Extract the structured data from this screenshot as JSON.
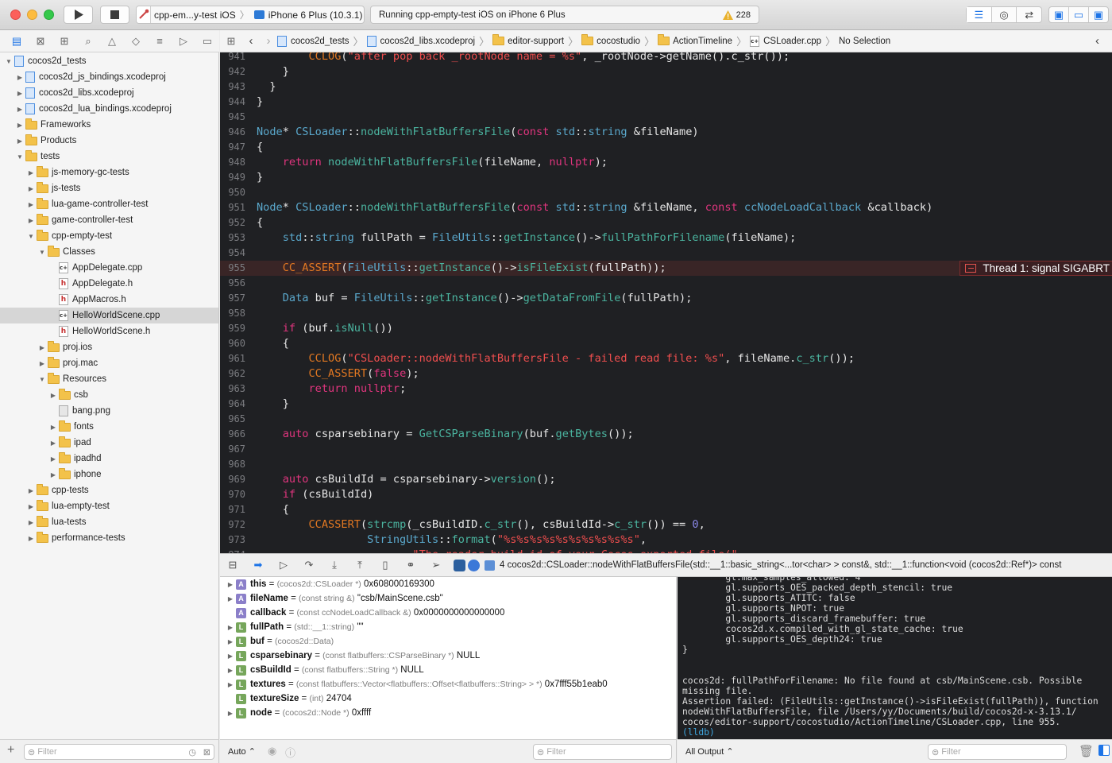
{
  "toolbar": {
    "scheme_name": "cpp-em...y-test iOS",
    "device_name": "iPhone 6 Plus (10.3.1)",
    "status_text": "Running cpp-empty-test iOS on iPhone 6 Plus",
    "warning_count": "228"
  },
  "navigator": {
    "filter_placeholder": "Filter",
    "items": [
      {
        "label": "cocos2d_tests",
        "icon": "project",
        "depth": 0,
        "disclosure": "open"
      },
      {
        "label": "cocos2d_js_bindings.xcodeproj",
        "icon": "project",
        "depth": 1,
        "disclosure": "closed"
      },
      {
        "label": "cocos2d_libs.xcodeproj",
        "icon": "project",
        "depth": 1,
        "disclosure": "closed"
      },
      {
        "label": "cocos2d_lua_bindings.xcodeproj",
        "icon": "project",
        "depth": 1,
        "disclosure": "closed"
      },
      {
        "label": "Frameworks",
        "icon": "folder",
        "depth": 1,
        "disclosure": "closed"
      },
      {
        "label": "Products",
        "icon": "folder",
        "depth": 1,
        "disclosure": "closed"
      },
      {
        "label": "tests",
        "icon": "folder",
        "depth": 1,
        "disclosure": "open"
      },
      {
        "label": "js-memory-gc-tests",
        "icon": "folder",
        "depth": 2,
        "disclosure": "closed"
      },
      {
        "label": "js-tests",
        "icon": "folder",
        "depth": 2,
        "disclosure": "closed"
      },
      {
        "label": "lua-game-controller-test",
        "icon": "folder",
        "depth": 2,
        "disclosure": "closed"
      },
      {
        "label": "game-controller-test",
        "icon": "folder",
        "depth": 2,
        "disclosure": "closed"
      },
      {
        "label": "cpp-empty-test",
        "icon": "folder",
        "depth": 2,
        "disclosure": "open"
      },
      {
        "label": "Classes",
        "icon": "folder",
        "depth": 3,
        "disclosure": "open"
      },
      {
        "label": "AppDelegate.cpp",
        "icon": "cpp",
        "depth": 4,
        "disclosure": "none"
      },
      {
        "label": "AppDelegate.h",
        "icon": "h",
        "depth": 4,
        "disclosure": "none"
      },
      {
        "label": "AppMacros.h",
        "icon": "h",
        "depth": 4,
        "disclosure": "none"
      },
      {
        "label": "HelloWorldScene.cpp",
        "icon": "cpp",
        "depth": 4,
        "disclosure": "none",
        "selected": true
      },
      {
        "label": "HelloWorldScene.h",
        "icon": "h",
        "depth": 4,
        "disclosure": "none"
      },
      {
        "label": "proj.ios",
        "icon": "folder",
        "depth": 3,
        "disclosure": "closed"
      },
      {
        "label": "proj.mac",
        "icon": "folder",
        "depth": 3,
        "disclosure": "closed"
      },
      {
        "label": "Resources",
        "icon": "folder",
        "depth": 3,
        "disclosure": "open"
      },
      {
        "label": "csb",
        "icon": "folder",
        "depth": 4,
        "disclosure": "closed"
      },
      {
        "label": "bang.png",
        "icon": "image",
        "depth": 4,
        "disclosure": "none"
      },
      {
        "label": "fonts",
        "icon": "folder",
        "depth": 4,
        "disclosure": "closed"
      },
      {
        "label": "ipad",
        "icon": "folder",
        "depth": 4,
        "disclosure": "closed"
      },
      {
        "label": "ipadhd",
        "icon": "folder",
        "depth": 4,
        "disclosure": "closed"
      },
      {
        "label": "iphone",
        "icon": "folder",
        "depth": 4,
        "disclosure": "closed"
      },
      {
        "label": "cpp-tests",
        "icon": "folder",
        "depth": 2,
        "disclosure": "closed"
      },
      {
        "label": "lua-empty-test",
        "icon": "folder",
        "depth": 2,
        "disclosure": "closed"
      },
      {
        "label": "lua-tests",
        "icon": "folder",
        "depth": 2,
        "disclosure": "closed"
      },
      {
        "label": "performance-tests",
        "icon": "folder",
        "depth": 2,
        "disclosure": "closed"
      }
    ]
  },
  "jumpbar": {
    "crumbs": [
      "cocos2d_tests",
      "cocos2d_libs.xcodeproj",
      "editor-support",
      "cocostudio",
      "ActionTimeline",
      "CSLoader.cpp",
      "No Selection"
    ]
  },
  "editor": {
    "error_badge": "Thread 1: signal SIGABRT",
    "error_line": "955",
    "lines": [
      {
        "n": "941",
        "code": [
          [
            "        ",
            ""
          ],
          [
            "CCLOG",
            "mc"
          ],
          [
            "(",
            ""
          ],
          [
            "\"after pop back _rootNode name = %s\"",
            "st"
          ],
          [
            ", _rootNode->getName().c_str());",
            ""
          ]
        ]
      },
      {
        "n": "942",
        "code": [
          [
            "    }",
            ""
          ]
        ]
      },
      {
        "n": "943",
        "code": [
          [
            "  }",
            ""
          ]
        ]
      },
      {
        "n": "944",
        "code": [
          [
            "}",
            ""
          ]
        ]
      },
      {
        "n": "945",
        "code": []
      },
      {
        "n": "946",
        "code": [
          [
            "Node",
            "ty"
          ],
          [
            "* ",
            ""
          ],
          [
            "CSLoader",
            "ty"
          ],
          [
            "::",
            ""
          ],
          [
            "nodeWithFlatBuffersFile",
            "fn"
          ],
          [
            "(",
            ""
          ],
          [
            "const",
            "kw"
          ],
          [
            " ",
            ""
          ],
          [
            "std",
            "ty"
          ],
          [
            "::",
            ""
          ],
          [
            "string",
            "ty"
          ],
          [
            " &fileName)",
            ""
          ]
        ]
      },
      {
        "n": "947",
        "code": [
          [
            "{",
            ""
          ]
        ]
      },
      {
        "n": "948",
        "code": [
          [
            "    ",
            ""
          ],
          [
            "return",
            "kw"
          ],
          [
            " ",
            ""
          ],
          [
            "nodeWithFlatBuffersFile",
            "fn"
          ],
          [
            "(fileName, ",
            ""
          ],
          [
            "nullptr",
            "kw"
          ],
          [
            ");",
            ""
          ]
        ]
      },
      {
        "n": "949",
        "code": [
          [
            "}",
            ""
          ]
        ]
      },
      {
        "n": "950",
        "code": []
      },
      {
        "n": "951",
        "code": [
          [
            "Node",
            "ty"
          ],
          [
            "* ",
            ""
          ],
          [
            "CSLoader",
            "ty"
          ],
          [
            "::",
            ""
          ],
          [
            "nodeWithFlatBuffersFile",
            "fn"
          ],
          [
            "(",
            ""
          ],
          [
            "const",
            "kw"
          ],
          [
            " ",
            ""
          ],
          [
            "std",
            "ty"
          ],
          [
            "::",
            ""
          ],
          [
            "string",
            "ty"
          ],
          [
            " &fileName, ",
            ""
          ],
          [
            "const",
            "kw"
          ],
          [
            " ",
            ""
          ],
          [
            "ccNodeLoadCallback",
            "ty"
          ],
          [
            " &callback)",
            ""
          ]
        ]
      },
      {
        "n": "952",
        "code": [
          [
            "{",
            ""
          ]
        ]
      },
      {
        "n": "953",
        "code": [
          [
            "    ",
            ""
          ],
          [
            "std",
            "ty"
          ],
          [
            "::",
            ""
          ],
          [
            "string",
            "ty"
          ],
          [
            " fullPath = ",
            ""
          ],
          [
            "FileUtils",
            "ty"
          ],
          [
            "::",
            ""
          ],
          [
            "getInstance",
            "fn"
          ],
          [
            "()->",
            ""
          ],
          [
            "fullPathForFilename",
            "fn"
          ],
          [
            "(fileName);",
            ""
          ]
        ]
      },
      {
        "n": "954",
        "code": []
      },
      {
        "n": "955",
        "code": [
          [
            "    ",
            ""
          ],
          [
            "CC_ASSERT",
            "mc"
          ],
          [
            "(",
            ""
          ],
          [
            "FileUtils",
            "ty"
          ],
          [
            "::",
            ""
          ],
          [
            "getInstance",
            "fn"
          ],
          [
            "()->",
            ""
          ],
          [
            "isFileExist",
            "fn"
          ],
          [
            "(fullPath));",
            ""
          ]
        ]
      },
      {
        "n": "956",
        "code": []
      },
      {
        "n": "957",
        "code": [
          [
            "    ",
            ""
          ],
          [
            "Data",
            "ty"
          ],
          [
            " buf = ",
            ""
          ],
          [
            "FileUtils",
            "ty"
          ],
          [
            "::",
            ""
          ],
          [
            "getInstance",
            "fn"
          ],
          [
            "()->",
            ""
          ],
          [
            "getDataFromFile",
            "fn"
          ],
          [
            "(fullPath);",
            ""
          ]
        ]
      },
      {
        "n": "958",
        "code": []
      },
      {
        "n": "959",
        "code": [
          [
            "    ",
            ""
          ],
          [
            "if",
            "kw"
          ],
          [
            " (buf.",
            ""
          ],
          [
            "isNull",
            "fn"
          ],
          [
            "())",
            ""
          ]
        ]
      },
      {
        "n": "960",
        "code": [
          [
            "    {",
            ""
          ]
        ]
      },
      {
        "n": "961",
        "code": [
          [
            "        ",
            ""
          ],
          [
            "CCLOG",
            "mc"
          ],
          [
            "(",
            ""
          ],
          [
            "\"CSLoader::nodeWithFlatBuffersFile - failed read file: %s\"",
            "st"
          ],
          [
            ", fileName.",
            ""
          ],
          [
            "c_str",
            "fn"
          ],
          [
            "());",
            ""
          ]
        ]
      },
      {
        "n": "962",
        "code": [
          [
            "        ",
            ""
          ],
          [
            "CC_ASSERT",
            "mc"
          ],
          [
            "(",
            ""
          ],
          [
            "false",
            "kw"
          ],
          [
            ");",
            ""
          ]
        ]
      },
      {
        "n": "963",
        "code": [
          [
            "        ",
            ""
          ],
          [
            "return",
            "kw"
          ],
          [
            " ",
            ""
          ],
          [
            "nullptr",
            "kw"
          ],
          [
            ";",
            ""
          ]
        ]
      },
      {
        "n": "964",
        "code": [
          [
            "    }",
            ""
          ]
        ]
      },
      {
        "n": "965",
        "code": []
      },
      {
        "n": "966",
        "code": [
          [
            "    ",
            ""
          ],
          [
            "auto",
            "kw"
          ],
          [
            " csparsebinary = ",
            ""
          ],
          [
            "GetCSParseBinary",
            "fn"
          ],
          [
            "(buf.",
            ""
          ],
          [
            "getBytes",
            "fn"
          ],
          [
            "());",
            ""
          ]
        ]
      },
      {
        "n": "967",
        "code": []
      },
      {
        "n": "968",
        "code": []
      },
      {
        "n": "969",
        "code": [
          [
            "    ",
            ""
          ],
          [
            "auto",
            "kw"
          ],
          [
            " csBuildId = csparsebinary->",
            ""
          ],
          [
            "version",
            "fn"
          ],
          [
            "();",
            ""
          ]
        ]
      },
      {
        "n": "970",
        "code": [
          [
            "    ",
            ""
          ],
          [
            "if",
            "kw"
          ],
          [
            " (csBuildId)",
            ""
          ]
        ]
      },
      {
        "n": "971",
        "code": [
          [
            "    {",
            ""
          ]
        ]
      },
      {
        "n": "972",
        "code": [
          [
            "        ",
            ""
          ],
          [
            "CCASSERT",
            "mc"
          ],
          [
            "(",
            ""
          ],
          [
            "strcmp",
            "fn"
          ],
          [
            "(_csBuildID.",
            ""
          ],
          [
            "c_str",
            "fn"
          ],
          [
            "(), csBuildId->",
            ""
          ],
          [
            "c_str",
            "fn"
          ],
          [
            "()) == ",
            ""
          ],
          [
            "0",
            "nm"
          ],
          [
            ",",
            ""
          ]
        ]
      },
      {
        "n": "973",
        "code": [
          [
            "                 ",
            ""
          ],
          [
            "StringUtils",
            "ty"
          ],
          [
            "::",
            ""
          ],
          [
            "format",
            "fn"
          ],
          [
            "(",
            ""
          ],
          [
            "\"%s%s%s%s%s%s%s%s%s%s\"",
            "st"
          ],
          [
            ",",
            ""
          ]
        ]
      },
      {
        "n": "974",
        "code": [
          [
            "                        ",
            ""
          ],
          [
            "\"The reader build id of your Cocos exported file(\"",
            "st"
          ]
        ]
      }
    ]
  },
  "debugbar": {
    "frame_label": "4 cocos2d::CSLoader::nodeWithFlatBuffersFile(std::__1::basic_string<...tor<char> > const&, std::__1::function<void (cocos2d::Ref*)> const"
  },
  "variables": {
    "scope_label": "Auto",
    "filter_placeholder": "Filter",
    "rows": [
      {
        "badge": "A",
        "name": "this",
        "type": "(cocos2d::CSLoader *)",
        "value": "0x608000169300",
        "expandable": true
      },
      {
        "badge": "A",
        "name": "fileName",
        "type": "(const string &)",
        "value": "\"csb/MainScene.csb\"",
        "expandable": true
      },
      {
        "badge": "A",
        "name": "callback",
        "type": "(const ccNodeLoadCallback &)",
        "value": "0x0000000000000000",
        "expandable": false
      },
      {
        "badge": "L",
        "name": "fullPath",
        "type": "(std::__1::string)",
        "value": "\"\"",
        "expandable": true
      },
      {
        "badge": "L",
        "name": "buf",
        "type": "(cocos2d::Data)",
        "value": "",
        "expandable": true
      },
      {
        "badge": "L",
        "name": "csparsebinary",
        "type": "(const flatbuffers::CSParseBinary *)",
        "value": "NULL",
        "expandable": true
      },
      {
        "badge": "L",
        "name": "csBuildId",
        "type": "(const flatbuffers::String *)",
        "value": "NULL",
        "expandable": true
      },
      {
        "badge": "L",
        "name": "textures",
        "type": "(const flatbuffers::Vector<flatbuffers::Offset<flatbuffers::String> > *)",
        "value": "0x7fff55b1eab0",
        "expandable": true
      },
      {
        "badge": "L",
        "name": "textureSize",
        "type": "(int)",
        "value": "24704",
        "expandable": false
      },
      {
        "badge": "L",
        "name": "node",
        "type": "(cocos2d::Node *)",
        "value": "0xffff",
        "expandable": true
      }
    ]
  },
  "console": {
    "output_label": "All Output",
    "filter_placeholder": "Filter",
    "lines": [
      "        gl.max_samples_allowed: 4",
      "        gl.supports_OES_packed_depth_stencil: true",
      "        gl.supports_ATITC: false",
      "        gl.supports_NPOT: true",
      "        gl.supports_discard_framebuffer: true",
      "        cocos2d.x.compiled_with_gl_state_cache: true",
      "        gl.supports_OES_depth24: true",
      "}",
      "",
      "",
      "cocos2d: fullPathForFilename: No file found at csb/MainScene.csb. Possible",
      "missing file.",
      "Assertion failed: (FileUtils::getInstance()->isFileExist(fullPath)), function",
      "nodeWithFlatBuffersFile, file /Users/yy/Documents/build/cocos2d-x-3.13.1/",
      "cocos/editor-support/cocostudio/ActionTimeline/CSLoader.cpp, line 955.",
      "(lldb)"
    ]
  },
  "colors": {
    "editor_bg": "#1f2023",
    "error_line_bg": "#392526",
    "keyword": "#e0357e",
    "type": "#5aa8cc",
    "function": "#4bb5a0",
    "string": "#ef4e4e",
    "macro": "#e27822",
    "accent": "#1d74e7"
  }
}
